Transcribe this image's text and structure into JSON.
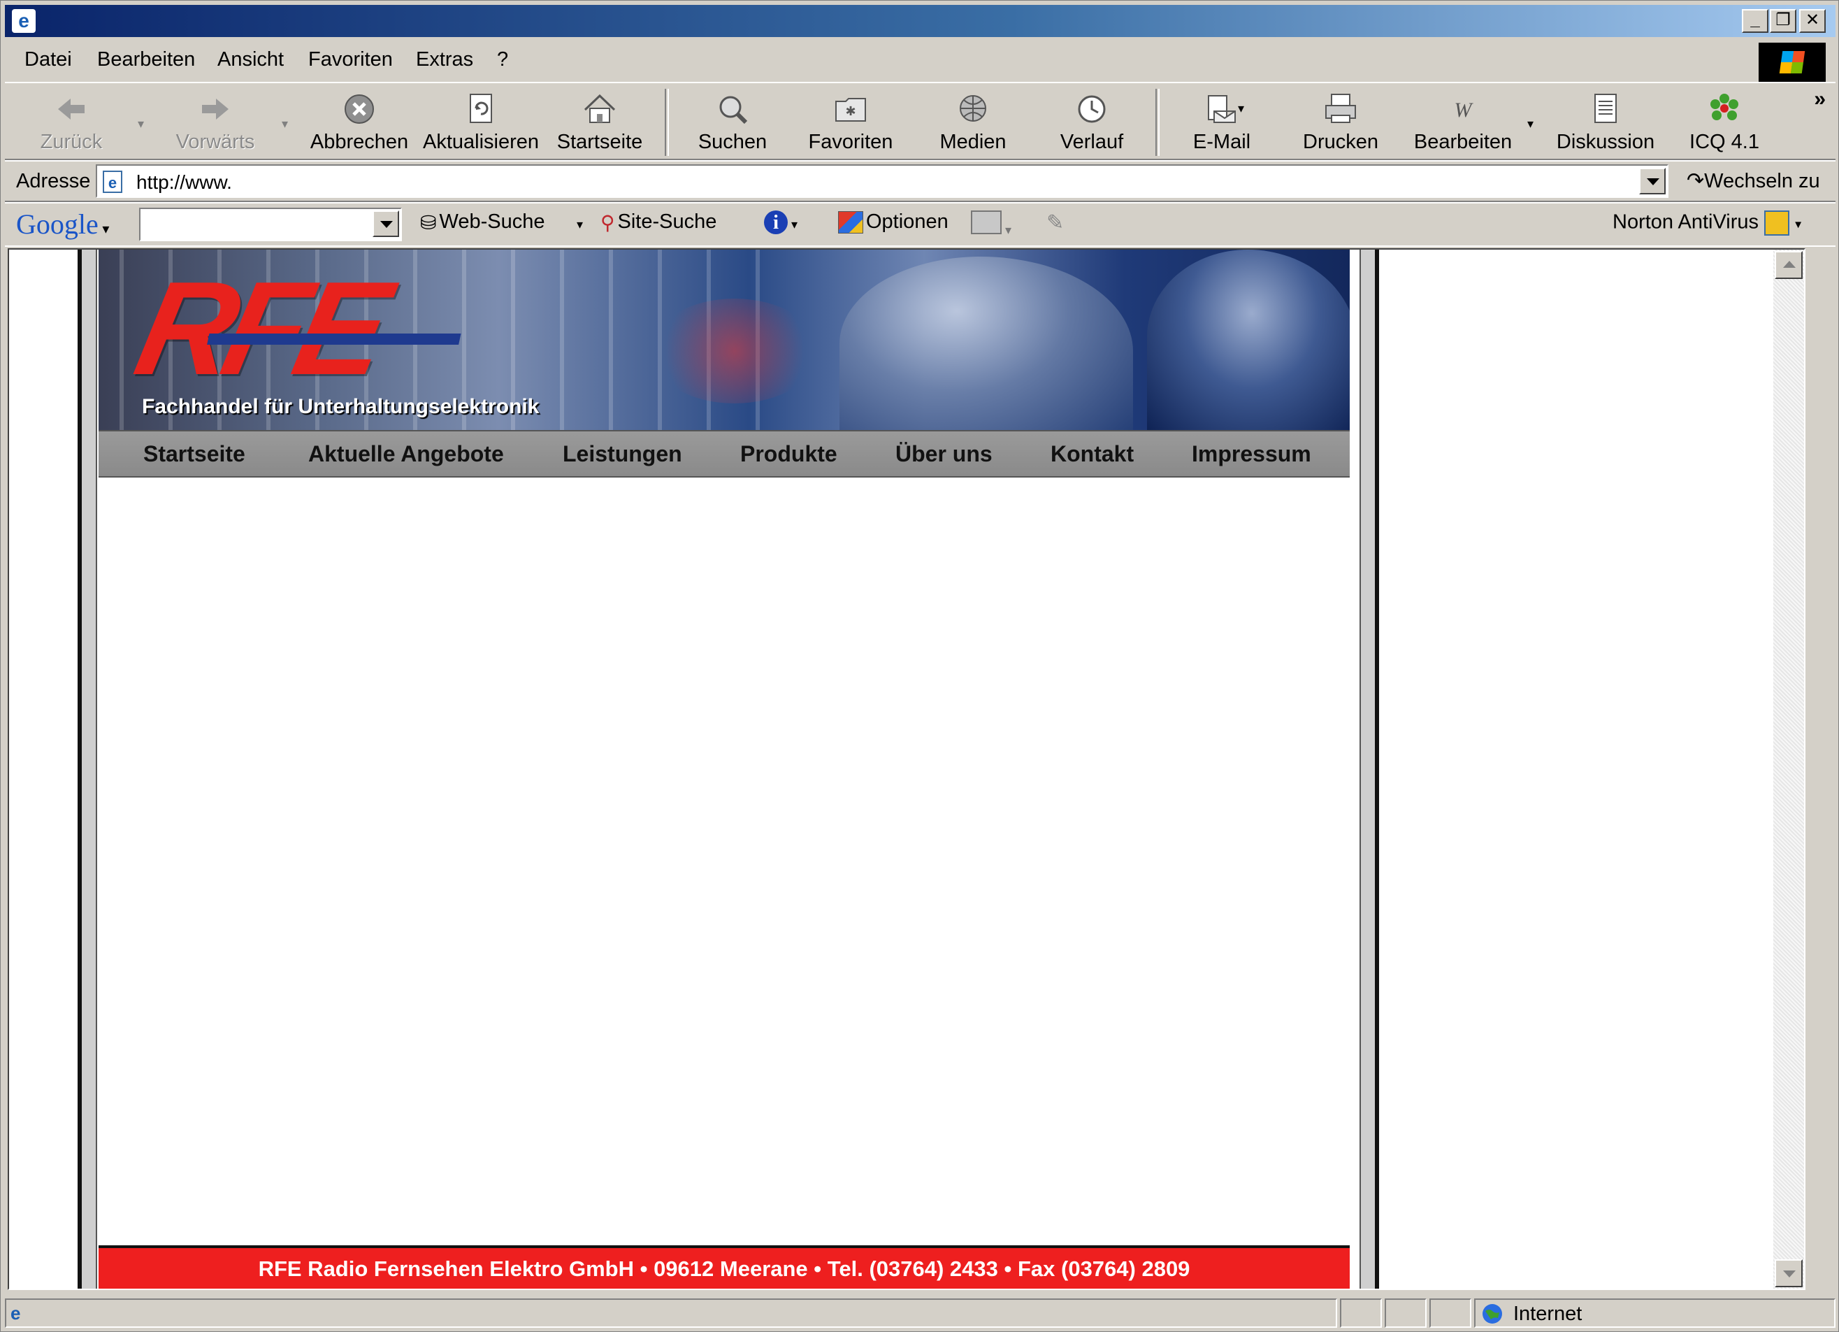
{
  "menu": [
    "Datei",
    "Bearbeiten",
    "Ansicht",
    "Favoriten",
    "Extras",
    "?"
  ],
  "toolbar": {
    "back": "Zurück",
    "forward": "Vorwärts",
    "stop": "Abbrechen",
    "refresh": "Aktualisieren",
    "home": "Startseite",
    "search": "Suchen",
    "favorites": "Favoriten",
    "media": "Medien",
    "history": "Verlauf",
    "mail": "E-Mail",
    "print": "Drucken",
    "edit": "Bearbeiten",
    "discuss": "Diskussion",
    "icq": "ICQ 4.1",
    "more": "»"
  },
  "address": {
    "label": "Adresse",
    "url": "http://www.",
    "go": "Wechseln zu"
  },
  "google_bar": {
    "logo": "Google",
    "web_search": "Web-Suche",
    "site_search": "Site-Suche",
    "options": "Optionen",
    "norton": "Norton AntiVirus"
  },
  "page": {
    "tagline": "Fachhandel für Unterhaltungselektronik",
    "logo_text": "RFE",
    "nav": [
      "Startseite",
      "Aktuelle Angebote",
      "Leistungen",
      "Produkte",
      "Über uns",
      "Kontakt",
      "Impressum"
    ],
    "footer": "RFE Radio Fernsehen Elektro GmbH • 09612 Meerane • Tel. (03764) 2433 • Fax (03764) 2809"
  },
  "status": {
    "zone": "Internet"
  },
  "colors": {
    "title_bar": "#0a246a",
    "brand_red": "#ee1f1f",
    "nav_gray": "#8f8f8f"
  }
}
